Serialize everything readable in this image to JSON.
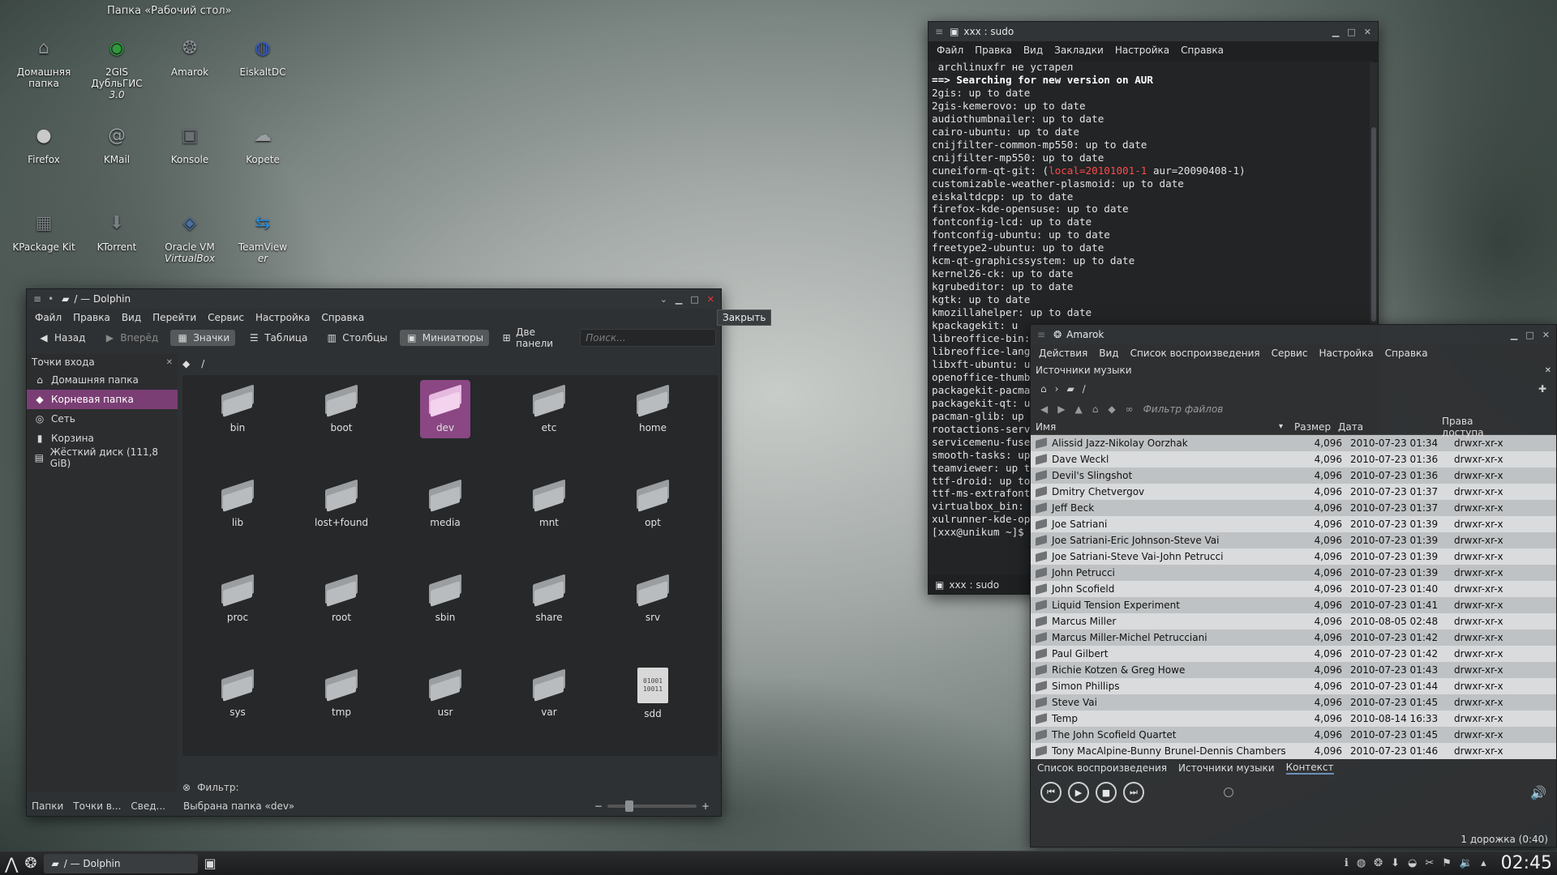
{
  "desktop": {
    "title": "Папка «Рабочий стол»",
    "icons": [
      {
        "label": "Домашняя папка",
        "sub": "",
        "icon": "home-icon",
        "glyph": "⌂",
        "color": "#8a8f94"
      },
      {
        "label": "2GIS ДубльГИС",
        "sub": "3.0",
        "icon": "2gis-icon",
        "glyph": "◉",
        "color": "#2e9a3a"
      },
      {
        "label": "Amarok",
        "sub": "",
        "icon": "amarok-wolf-icon",
        "glyph": "❂",
        "color": "#8a8f94"
      },
      {
        "label": "EiskaltDC",
        "sub": "",
        "icon": "eiskaltdc-globe-icon",
        "glyph": "◍",
        "color": "#3a5ec9"
      },
      {
        "label": "Firefox",
        "sub": "",
        "icon": "firefox-icon",
        "glyph": "●",
        "color": "#c9c9c9"
      },
      {
        "label": "KMail",
        "sub": "",
        "icon": "kmail-icon",
        "glyph": "@",
        "color": "#9a9ea1"
      },
      {
        "label": "Konsole",
        "sub": "",
        "icon": "konsole-icon",
        "glyph": "▣",
        "color": "#6a6f73"
      },
      {
        "label": "Kopete",
        "sub": "",
        "icon": "kopete-icon",
        "glyph": "☁",
        "color": "#9a9ea1"
      },
      {
        "label": "KPackage Kit",
        "sub": "",
        "icon": "kpackagekit-icon",
        "glyph": "▦",
        "color": "#7a7f83"
      },
      {
        "label": "KTorrent",
        "sub": "",
        "icon": "ktorrent-icon",
        "glyph": "⬇",
        "color": "#7a7f83"
      },
      {
        "label": "Oracle VM",
        "sub": "VirtualBox",
        "icon": "virtualbox-icon",
        "glyph": "◈",
        "color": "#4a6fa0"
      },
      {
        "label": "TeamView",
        "sub": "er",
        "icon": "teamviewer-icon",
        "glyph": "⇆",
        "color": "#2a8ad4"
      }
    ]
  },
  "dolphin": {
    "title": "/ — Dolphin",
    "menu": [
      "Файл",
      "Правка",
      "Вид",
      "Перейти",
      "Сервис",
      "Настройка",
      "Справка"
    ],
    "toolbar": {
      "back": "Назад",
      "forward": "Вперёд",
      "icons": "Значки",
      "table": "Таблица",
      "columns": "Столбцы",
      "previews": "Миниатюры",
      "split": "Две панели",
      "search_placeholder": "Поиск..."
    },
    "places_title": "Точки входа",
    "places": [
      {
        "label": "Домашняя папка",
        "icon": "home-icon",
        "selected": false
      },
      {
        "label": "Корневая папка",
        "icon": "folder-red-icon",
        "selected": true
      },
      {
        "label": "Сеть",
        "icon": "network-icon",
        "selected": false
      },
      {
        "label": "Корзина",
        "icon": "trash-icon",
        "selected": false
      },
      {
        "label": "Жёсткий диск (111,8 GiB)",
        "icon": "harddisk-icon",
        "selected": false
      }
    ],
    "breadcrumb": "/",
    "files": [
      {
        "name": "bin",
        "type": "folder",
        "selected": false
      },
      {
        "name": "boot",
        "type": "folder",
        "selected": false
      },
      {
        "name": "dev",
        "type": "folder",
        "selected": true
      },
      {
        "name": "etc",
        "type": "folder",
        "selected": false
      },
      {
        "name": "home",
        "type": "folder",
        "selected": false
      },
      {
        "name": "lib",
        "type": "folder",
        "selected": false
      },
      {
        "name": "lost+found",
        "type": "folder",
        "selected": false
      },
      {
        "name": "media",
        "type": "folder",
        "selected": false
      },
      {
        "name": "mnt",
        "type": "folder",
        "selected": false
      },
      {
        "name": "opt",
        "type": "folder",
        "selected": false
      },
      {
        "name": "proc",
        "type": "folder",
        "selected": false
      },
      {
        "name": "root",
        "type": "folder",
        "selected": false
      },
      {
        "name": "sbin",
        "type": "folder",
        "selected": false
      },
      {
        "name": "share",
        "type": "folder",
        "selected": false
      },
      {
        "name": "srv",
        "type": "folder",
        "selected": false
      },
      {
        "name": "sys",
        "type": "folder",
        "selected": false
      },
      {
        "name": "tmp",
        "type": "folder",
        "selected": false
      },
      {
        "name": "usr",
        "type": "folder",
        "selected": false
      },
      {
        "name": "var",
        "type": "folder",
        "selected": false
      },
      {
        "name": "sdd",
        "type": "binary",
        "selected": false,
        "badge": "01001 10011"
      }
    ],
    "filter_label": "Фильтр:",
    "status_tabs": [
      "Папки",
      "Точки в...",
      "Свед..."
    ],
    "status_text": "Выбрана папка «dev»",
    "tooltip": "Закрыть"
  },
  "konsole": {
    "title": "xxx : sudo",
    "menu": [
      "Файл",
      "Правка",
      "Вид",
      "Закладки",
      "Настройка",
      "Справка"
    ],
    "lines": [
      {
        "t": " archlinuxfr не устарел"
      },
      {
        "t": "==> Searching for new version on AUR",
        "style": "arrow"
      },
      {
        "t": "2gis: up to date"
      },
      {
        "t": "2gis-kemerovo: up to date"
      },
      {
        "t": "audiothumbnailer: up to date"
      },
      {
        "t": "cairo-ubuntu: up to date"
      },
      {
        "t": "cnijfilter-common-mp550: up to date"
      },
      {
        "t": "cnijfilter-mp550: up to date"
      },
      {
        "t": "cuneiform-qt-git: (",
        "red": "local=20101001-1",
        "rest": " aur=20090408-1)"
      },
      {
        "t": "customizable-weather-plasmoid: up to date"
      },
      {
        "t": "eiskaltdcpp: up to date"
      },
      {
        "t": "firefox-kde-opensuse: up to date"
      },
      {
        "t": "fontconfig-lcd: up to date"
      },
      {
        "t": "fontconfig-ubuntu: up to date"
      },
      {
        "t": "freetype2-ubuntu: up to date"
      },
      {
        "t": "kcm-qt-graphicssystem: up to date"
      },
      {
        "t": "kernel26-ck: up to date"
      },
      {
        "t": "kgrubeditor: up to date"
      },
      {
        "t": "kgtk: up to date"
      },
      {
        "t": "kmozillahelper: up to date"
      },
      {
        "t": "kpackagekit: u"
      },
      {
        "t": "libreoffice-bin:"
      },
      {
        "t": "libreoffice-lang"
      },
      {
        "t": "libxft-ubuntu: u"
      },
      {
        "t": "openoffice-thumb"
      },
      {
        "t": "packagekit-pacma"
      },
      {
        "t": "packagekit-qt: u"
      },
      {
        "t": "pacman-glib: up"
      },
      {
        "t": "rootactions-serv"
      },
      {
        "t": "servicemenu-fuse"
      },
      {
        "t": "smooth-tasks: up"
      },
      {
        "t": "teamviewer: up t"
      },
      {
        "t": "ttf-droid: up to"
      },
      {
        "t": "ttf-ms-extrafont"
      },
      {
        "t": "virtualbox_bin:"
      },
      {
        "t": "xulrunner-kde-op"
      },
      {
        "t": ""
      },
      {
        "t": "[xxx@unikum ~]$"
      }
    ],
    "tab": "xxx : sudo"
  },
  "amarok": {
    "title": "Amarok",
    "menu": [
      "Действия",
      "Вид",
      "Список воспроизведения",
      "Сервис",
      "Настройка",
      "Справка"
    ],
    "section": "Источники музыки",
    "path": "/",
    "filter_placeholder": "Фильтр файлов",
    "columns": [
      "Имя",
      "Размер",
      "Дата",
      "Права доступа"
    ],
    "rows": [
      [
        "Alissid Jazz-Nikolay Oorzhak",
        "4,096",
        "2010-07-23 01:34",
        "drwxr-xr-x"
      ],
      [
        "Dave Weckl",
        "4,096",
        "2010-07-23 01:36",
        "drwxr-xr-x"
      ],
      [
        "Devil's Slingshot",
        "4,096",
        "2010-07-23 01:36",
        "drwxr-xr-x"
      ],
      [
        "Dmitry Chetvergov",
        "4,096",
        "2010-07-23 01:37",
        "drwxr-xr-x"
      ],
      [
        "Jeff Beck",
        "4,096",
        "2010-07-23 01:37",
        "drwxr-xr-x"
      ],
      [
        "Joe Satriani",
        "4,096",
        "2010-07-23 01:39",
        "drwxr-xr-x"
      ],
      [
        "Joe Satriani-Eric Johnson-Steve Vai",
        "4,096",
        "2010-07-23 01:39",
        "drwxr-xr-x"
      ],
      [
        "Joe Satriani-Steve Vai-John Petrucci",
        "4,096",
        "2010-07-23 01:39",
        "drwxr-xr-x"
      ],
      [
        "John Petrucci",
        "4,096",
        "2010-07-23 01:39",
        "drwxr-xr-x"
      ],
      [
        "John Scofield",
        "4,096",
        "2010-07-23 01:40",
        "drwxr-xr-x"
      ],
      [
        "Liquid Tension Experiment",
        "4,096",
        "2010-07-23 01:41",
        "drwxr-xr-x"
      ],
      [
        "Marcus Miller",
        "4,096",
        "2010-08-05 02:48",
        "drwxr-xr-x"
      ],
      [
        "Marcus Miller-Michel Petrucciani",
        "4,096",
        "2010-07-23 01:42",
        "drwxr-xr-x"
      ],
      [
        "Paul Gilbert",
        "4,096",
        "2010-07-23 01:42",
        "drwxr-xr-x"
      ],
      [
        "Richie Kotzen & Greg Howe",
        "4,096",
        "2010-07-23 01:43",
        "drwxr-xr-x"
      ],
      [
        "Simon Phillips",
        "4,096",
        "2010-07-23 01:44",
        "drwxr-xr-x"
      ],
      [
        "Steve Vai",
        "4,096",
        "2010-07-23 01:45",
        "drwxr-xr-x"
      ],
      [
        "Temp",
        "4,096",
        "2010-08-14 16:33",
        "drwxr-xr-x"
      ],
      [
        "The John Scofield Quartet",
        "4,096",
        "2010-07-23 01:45",
        "drwxr-xr-x"
      ],
      [
        "Tony MacAlpine-Bunny Brunel-Dennis Chambers",
        "4,096",
        "2010-07-23 01:46",
        "drwxr-xr-x"
      ]
    ],
    "tabs": [
      "Список воспроизведения",
      "Источники музыки",
      "Контекст"
    ],
    "track_info": "1 дорожка (0:40)"
  },
  "taskbar": {
    "task": "/ — Dolphin",
    "clock": "02:45"
  }
}
